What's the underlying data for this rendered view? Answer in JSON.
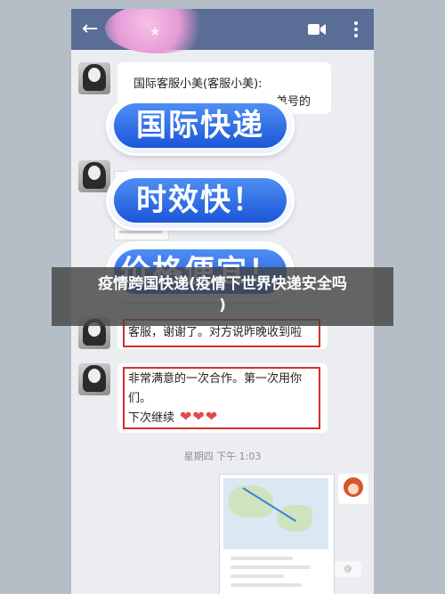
{
  "colors": {
    "topbar": "#5a6d96",
    "highlight_box": "#d62c2c",
    "pill_blue": "#2a66e6",
    "chat_bg": "#ecedf1"
  },
  "topbar": {
    "back_icon": "arrow-left-icon",
    "call_icon": "video-call-icon",
    "more_icon": "more-vertical-icon"
  },
  "messages": [
    {
      "sender": "国际客服小美(客服小美):",
      "text_fragment": "单号的"
    },
    {
      "text": "客服，谢谢了。对方说昨晚收到啦"
    },
    {
      "line1": "非常满意的一次合作。第一次用你",
      "line2": "们。",
      "line3": "下次继续",
      "emoji": "❤❤❤"
    }
  ],
  "banners": [
    "国际快递",
    "时效快！",
    "价格便宜！"
  ],
  "timestamp": "星期四 下午 1:03",
  "overlay": {
    "title": "疫情跨国快递(疫情下世界快递安全吗",
    "title_line2": ")"
  },
  "watermark": "@"
}
